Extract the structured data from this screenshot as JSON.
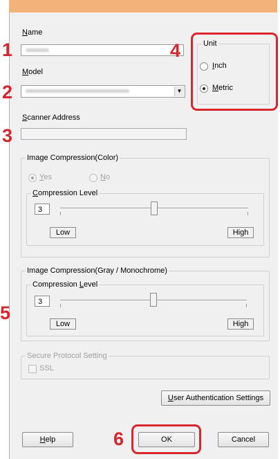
{
  "window": {
    "accent_color": "#d7262e",
    "titlebar_color": "#f3b27a"
  },
  "labels": {
    "name": "Name",
    "model": "Model",
    "scanner_address": "Scanner Address"
  },
  "unit": {
    "legend": "Unit",
    "options": [
      "Inch",
      "Metric"
    ],
    "selected": "Metric"
  },
  "color_compression": {
    "legend": "Image Compression(Color)",
    "yes_label": "Yes",
    "no_label": "No",
    "selected": "Yes",
    "level_legend": "Compression Level",
    "level_value": "3",
    "slider_level_fraction": 0.5,
    "low_label": "Low",
    "high_label": "High"
  },
  "gray_compression": {
    "legend": "Image Compression(Gray / Monochrome)",
    "level_legend": "Compression Level",
    "level_value": "3",
    "slider_level_fraction": 0.5,
    "low_label": "Low",
    "high_label": "High"
  },
  "secure_protocol": {
    "legend": "Secure Protocol Setting",
    "ssl_label": "SSL",
    "ssl_checked": false
  },
  "buttons": {
    "user_auth": "User Authentication Settings",
    "help": "Help",
    "ok": "OK",
    "cancel": "Cancel"
  },
  "callouts": [
    "1",
    "2",
    "3",
    "4",
    "5",
    "6"
  ],
  "icons": {
    "combo_dropdown": "chevron-down-icon"
  }
}
